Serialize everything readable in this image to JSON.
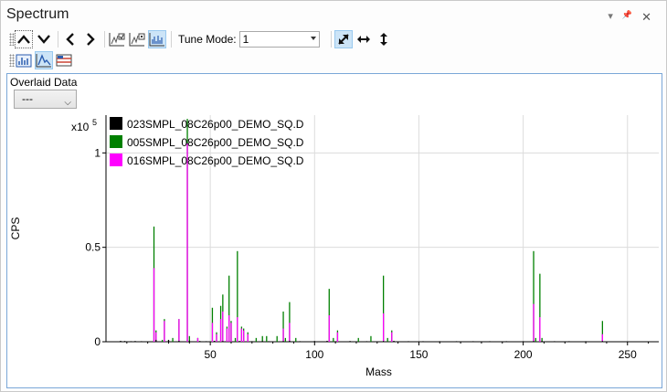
{
  "window": {
    "title": "Spectrum",
    "controls": [
      "▾",
      "📌",
      "✕"
    ]
  },
  "toolbar": {
    "tune_mode_label": "Tune Mode:",
    "tune_mode_value": "1"
  },
  "overlaid": {
    "label": "Overlaid Data",
    "value": "---"
  },
  "chart_data": {
    "type": "bar",
    "xlabel": "Mass",
    "ylabel": "CPS",
    "y_multiplier_label": "x10",
    "y_multiplier_exponent": "5",
    "xlim": [
      0,
      265
    ],
    "ylim": [
      0,
      1.2
    ],
    "x_ticks": [
      50,
      100,
      150,
      200,
      250
    ],
    "y_ticks": [
      0,
      0.5,
      1
    ],
    "y_tick_labels": [
      "0",
      "0.5",
      "1"
    ],
    "grid": true,
    "legend_position": "top-left",
    "series": [
      {
        "name": "023SMPL_08C26p00_DEMO_SQ.D",
        "color": "#000000",
        "points": [
          [
            7,
            0.005
          ],
          [
            9,
            0.004
          ],
          [
            12,
            0.003
          ],
          [
            14,
            0.004
          ],
          [
            17,
            0.003
          ],
          [
            24,
            0.01
          ],
          [
            30,
            0.01
          ],
          [
            35,
            0.005
          ],
          [
            40,
            0.006
          ],
          [
            45,
            0.004
          ],
          [
            48,
            0.003
          ],
          [
            52,
            0.005
          ],
          [
            56,
            0.004
          ],
          [
            64,
            0.004
          ],
          [
            70,
            0.003
          ],
          [
            75,
            0.004
          ],
          [
            78,
            0.003
          ],
          [
            85,
            0.004
          ],
          [
            88,
            0.005
          ],
          [
            93,
            0.003
          ],
          [
            100,
            0.004
          ],
          [
            106,
            0.005
          ],
          [
            110,
            0.003
          ],
          [
            117,
            0.004
          ],
          [
            125,
            0.003
          ],
          [
            133,
            0.004
          ],
          [
            138,
            0.005
          ],
          [
            145,
            0.003
          ],
          [
            152,
            0.003
          ],
          [
            160,
            0.003
          ],
          [
            168,
            0.003
          ],
          [
            176,
            0.003
          ],
          [
            184,
            0.003
          ],
          [
            192,
            0.003
          ],
          [
            200,
            0.003
          ],
          [
            205,
            0.004
          ],
          [
            209,
            0.004
          ],
          [
            215,
            0.003
          ],
          [
            222,
            0.003
          ],
          [
            230,
            0.003
          ],
          [
            238,
            0.004
          ]
        ]
      },
      {
        "name": "005SMPL_08C26p00_DEMO_SQ.D",
        "color": "#008000",
        "points": [
          [
            23,
            0.61
          ],
          [
            24,
            0.06
          ],
          [
            27,
            0.01
          ],
          [
            28,
            0.12
          ],
          [
            32,
            0.02
          ],
          [
            35,
            0.12
          ],
          [
            39,
            1.18
          ],
          [
            40,
            0.03
          ],
          [
            44,
            0.02
          ],
          [
            51,
            0.18
          ],
          [
            53,
            0.05
          ],
          [
            55,
            0.19
          ],
          [
            56,
            0.25
          ],
          [
            58,
            0.08
          ],
          [
            59,
            0.35
          ],
          [
            60,
            0.11
          ],
          [
            62,
            0.02
          ],
          [
            63,
            0.48
          ],
          [
            65,
            0.08
          ],
          [
            66,
            0.07
          ],
          [
            68,
            0.05
          ],
          [
            72,
            0.02
          ],
          [
            75,
            0.03
          ],
          [
            77,
            0.03
          ],
          [
            82,
            0.03
          ],
          [
            85,
            0.16
          ],
          [
            86,
            0.02
          ],
          [
            88,
            0.21
          ],
          [
            91,
            0.02
          ],
          [
            107,
            0.28
          ],
          [
            109,
            0.02
          ],
          [
            111,
            0.06
          ],
          [
            121,
            0.02
          ],
          [
            127,
            0.03
          ],
          [
            133,
            0.35
          ],
          [
            135,
            0.02
          ],
          [
            137,
            0.06
          ],
          [
            205,
            0.48
          ],
          [
            206,
            0.02
          ],
          [
            208,
            0.36
          ],
          [
            209,
            0.02
          ],
          [
            238,
            0.11
          ]
        ]
      },
      {
        "name": "016SMPL_08C26p00_DEMO_SQ.D",
        "color": "#ff00ff",
        "points": [
          [
            23,
            0.39
          ],
          [
            24,
            0.05
          ],
          [
            28,
            0.11
          ],
          [
            35,
            0.12
          ],
          [
            39,
            1.05
          ],
          [
            44,
            0.02
          ],
          [
            51,
            0.1
          ],
          [
            53,
            0.04
          ],
          [
            55,
            0.12
          ],
          [
            56,
            0.16
          ],
          [
            58,
            0.07
          ],
          [
            59,
            0.14
          ],
          [
            60,
            0.1
          ],
          [
            63,
            0.13
          ],
          [
            65,
            0.07
          ],
          [
            66,
            0.06
          ],
          [
            68,
            0.04
          ],
          [
            85,
            0.07
          ],
          [
            88,
            0.1
          ],
          [
            107,
            0.14
          ],
          [
            111,
            0.05
          ],
          [
            133,
            0.15
          ],
          [
            137,
            0.05
          ],
          [
            205,
            0.2
          ],
          [
            208,
            0.13
          ],
          [
            238,
            0.04
          ]
        ]
      }
    ]
  }
}
